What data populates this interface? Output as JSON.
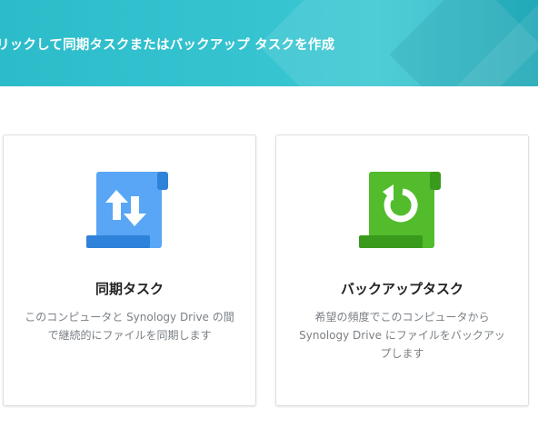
{
  "banner": {
    "text": "リックして同期タスクまたはバックアップ タスクを作成"
  },
  "cards": [
    {
      "title": "同期タスク",
      "desc_lines": [
        "このコンピュータと Synology Drive の間",
        "で継続的にファイルを同期します"
      ],
      "icon": "sync-arrows-icon",
      "color": "#4a9cf0"
    },
    {
      "title": "バックアップタスク",
      "desc_lines": [
        "希望の頻度でこのコンピュータから",
        "Synology Drive にファイルをバックアッ",
        "プします"
      ],
      "icon": "backup-restore-icon",
      "color": "#4bb22a"
    }
  ]
}
